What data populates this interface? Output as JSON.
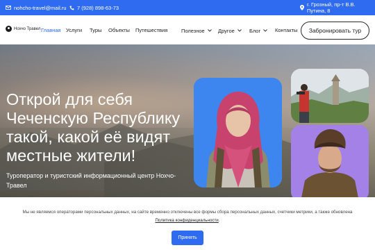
{
  "topbar": {
    "email": "nohcho-travel@mail.ru",
    "phone": "7 (928) 898-63-73",
    "address": "г. Грозный, пр-т В.В. Путина, 8",
    "email_icon": "mail-icon",
    "phone_icon": "phone-icon",
    "address_icon": "location-pin-icon"
  },
  "nav": {
    "logo_text": "Нохчо Травел",
    "items": [
      {
        "label": "Главная"
      },
      {
        "label": "Услуги"
      },
      {
        "label": "Туры"
      },
      {
        "label": "Объекты"
      },
      {
        "label": "Путешествия"
      },
      {
        "label": "Полезное"
      },
      {
        "label": "Другое"
      },
      {
        "label": "Блог"
      },
      {
        "label": "Контакты"
      }
    ],
    "book_label": "Забронировать тур"
  },
  "hero": {
    "title": "Открой для себя Чеченскую Республику такой, какой её видят местные жители!",
    "subtitle": "Туроператор и туристский информационный центр Нохчо-Травел"
  },
  "cookie": {
    "text": "Мы не являемся операторами персональных данных, на сайте временно отключены все формы сбора персональных данных, счетчики метрики, а также обновлена",
    "link": "Политика конфиденциальности",
    "link_suffix": ".",
    "accept_label": "Принять"
  },
  "colors": {
    "accent": "#2f6bf0",
    "card_blue": "#3d86f0",
    "card_purple": "#a481e6"
  }
}
